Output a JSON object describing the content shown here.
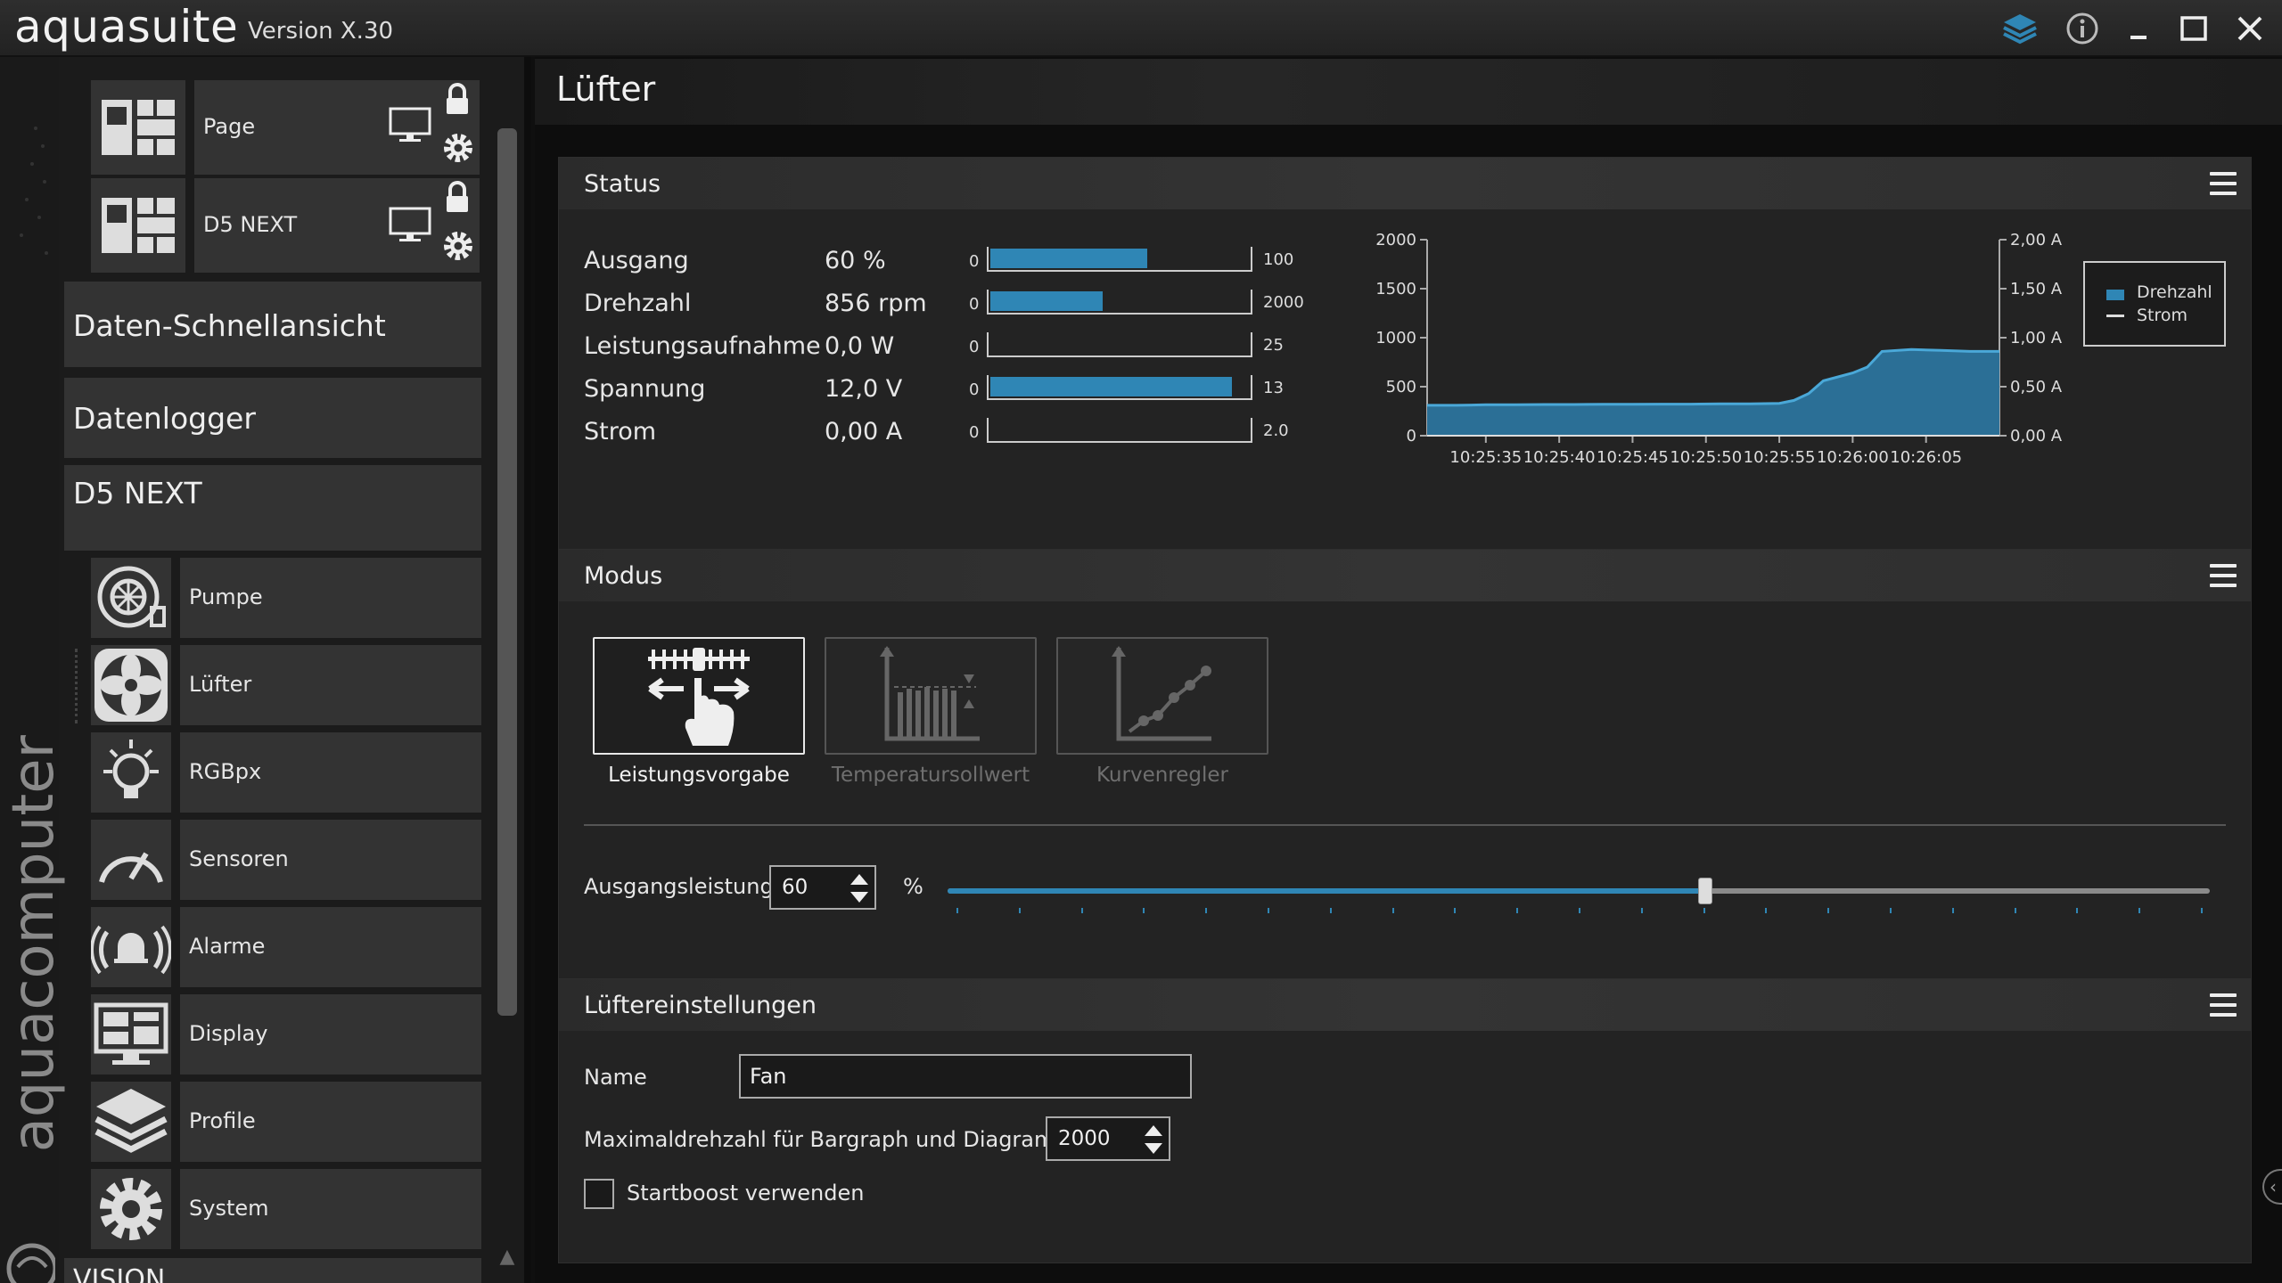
{
  "app": {
    "logo": "aquasuite",
    "version": "Version X.30",
    "brand_vertical": "aquacomputer",
    "sidebar_bottom_partial": "VISION"
  },
  "sidebar": {
    "pages": [
      {
        "label": "Page",
        "icon": "dashboard-icon"
      },
      {
        "label": "D5 NEXT",
        "icon": "dashboard-icon"
      }
    ],
    "sections": [
      {
        "label": "Daten-Schnellansicht"
      },
      {
        "label": "Datenlogger"
      },
      {
        "label": "D5 NEXT"
      }
    ],
    "items": [
      {
        "label": "Pumpe",
        "icon": "pump-icon"
      },
      {
        "label": "Lüfter",
        "icon": "fan-icon"
      },
      {
        "label": "RGBpx",
        "icon": "lightbulb-icon"
      },
      {
        "label": "Sensoren",
        "icon": "gauge-icon"
      },
      {
        "label": "Alarme",
        "icon": "bell-icon"
      },
      {
        "label": "Display",
        "icon": "monitor-icon"
      },
      {
        "label": "Profile",
        "icon": "layers-icon"
      },
      {
        "label": "System",
        "icon": "gear-icon"
      }
    ]
  },
  "main": {
    "title": "Lüfter",
    "status": {
      "header": "Status",
      "rows": [
        {
          "label": "Ausgang",
          "value": "60 %",
          "min": "0",
          "max": "100",
          "fraction": 0.6
        },
        {
          "label": "Drehzahl",
          "value": "856 rpm",
          "min": "0",
          "max": "2000",
          "fraction": 0.428
        },
        {
          "label": "Leistungsaufnahme",
          "value": "0,0 W",
          "min": "0",
          "max": "25",
          "fraction": 0.0
        },
        {
          "label": "Spannung",
          "value": "12,0 V",
          "min": "0",
          "max": "13",
          "fraction": 0.923
        },
        {
          "label": "Strom",
          "value": "0,00 A",
          "min": "0",
          "max": "2.0",
          "fraction": 0.0
        }
      ]
    },
    "modus": {
      "header": "Modus",
      "modes": [
        {
          "label": "Leistungsvorgabe",
          "active": true
        },
        {
          "label": "Temperatursollwert",
          "active": false
        },
        {
          "label": "Kurvenregler",
          "active": false
        }
      ],
      "output_label": "Ausgangsleistung",
      "output_value": "60",
      "output_unit": "%",
      "slider_fraction": 0.6
    },
    "fan_settings": {
      "header": "Lüftereinstellungen",
      "name_label": "Name",
      "name_value": "Fan",
      "max_rpm_label": "Maximaldrehzahl für Bargraph und Diagramm",
      "max_rpm_value": "2000",
      "startboost_label": "Startboost verwenden",
      "startboost_checked": false
    }
  },
  "colors": {
    "accent": "#2f86b5",
    "chart_fill": "#2b6f96",
    "chart_line": "#4aa8d8"
  },
  "chart_data": {
    "type": "area",
    "x": [
      "10:25:31",
      "10:25:33",
      "10:25:35",
      "10:25:37",
      "10:25:39",
      "10:25:41",
      "10:25:43",
      "10:25:45",
      "10:25:47",
      "10:25:49",
      "10:25:51",
      "10:25:53",
      "10:25:55",
      "10:25:56",
      "10:25:57",
      "10:25:58",
      "10:26:00",
      "10:26:01",
      "10:26:02",
      "10:26:04",
      "10:26:06",
      "10:26:08",
      "10:26:10"
    ],
    "x_ticks": [
      "10:25:35",
      "10:25:40",
      "10:25:45",
      "10:25:50",
      "10:25:55",
      "10:26:00",
      "10:26:05"
    ],
    "series": [
      {
        "name": "Drehzahl",
        "axis": "left",
        "values": [
          310,
          310,
          315,
          315,
          318,
          318,
          320,
          320,
          322,
          322,
          325,
          325,
          330,
          360,
          430,
          560,
          640,
          700,
          860,
          880,
          870,
          860,
          860
        ]
      },
      {
        "name": "Strom",
        "axis": "right",
        "values": [
          0,
          0,
          0,
          0,
          0,
          0,
          0,
          0,
          0,
          0,
          0,
          0,
          0,
          0,
          0,
          0,
          0,
          0,
          0,
          0,
          0,
          0,
          0
        ]
      }
    ],
    "ylim_left": [
      0,
      2000
    ],
    "yticks_left": [
      "0",
      "500",
      "1000",
      "1500",
      "2000"
    ],
    "ylim_right": [
      0,
      2.0
    ],
    "yticks_right": [
      "0,00 A",
      "0,50 A",
      "1,00 A",
      "1,50 A",
      "2,00 A"
    ],
    "legend": [
      "Drehzahl",
      "Strom"
    ],
    "legend_position": "right",
    "grid": false
  }
}
